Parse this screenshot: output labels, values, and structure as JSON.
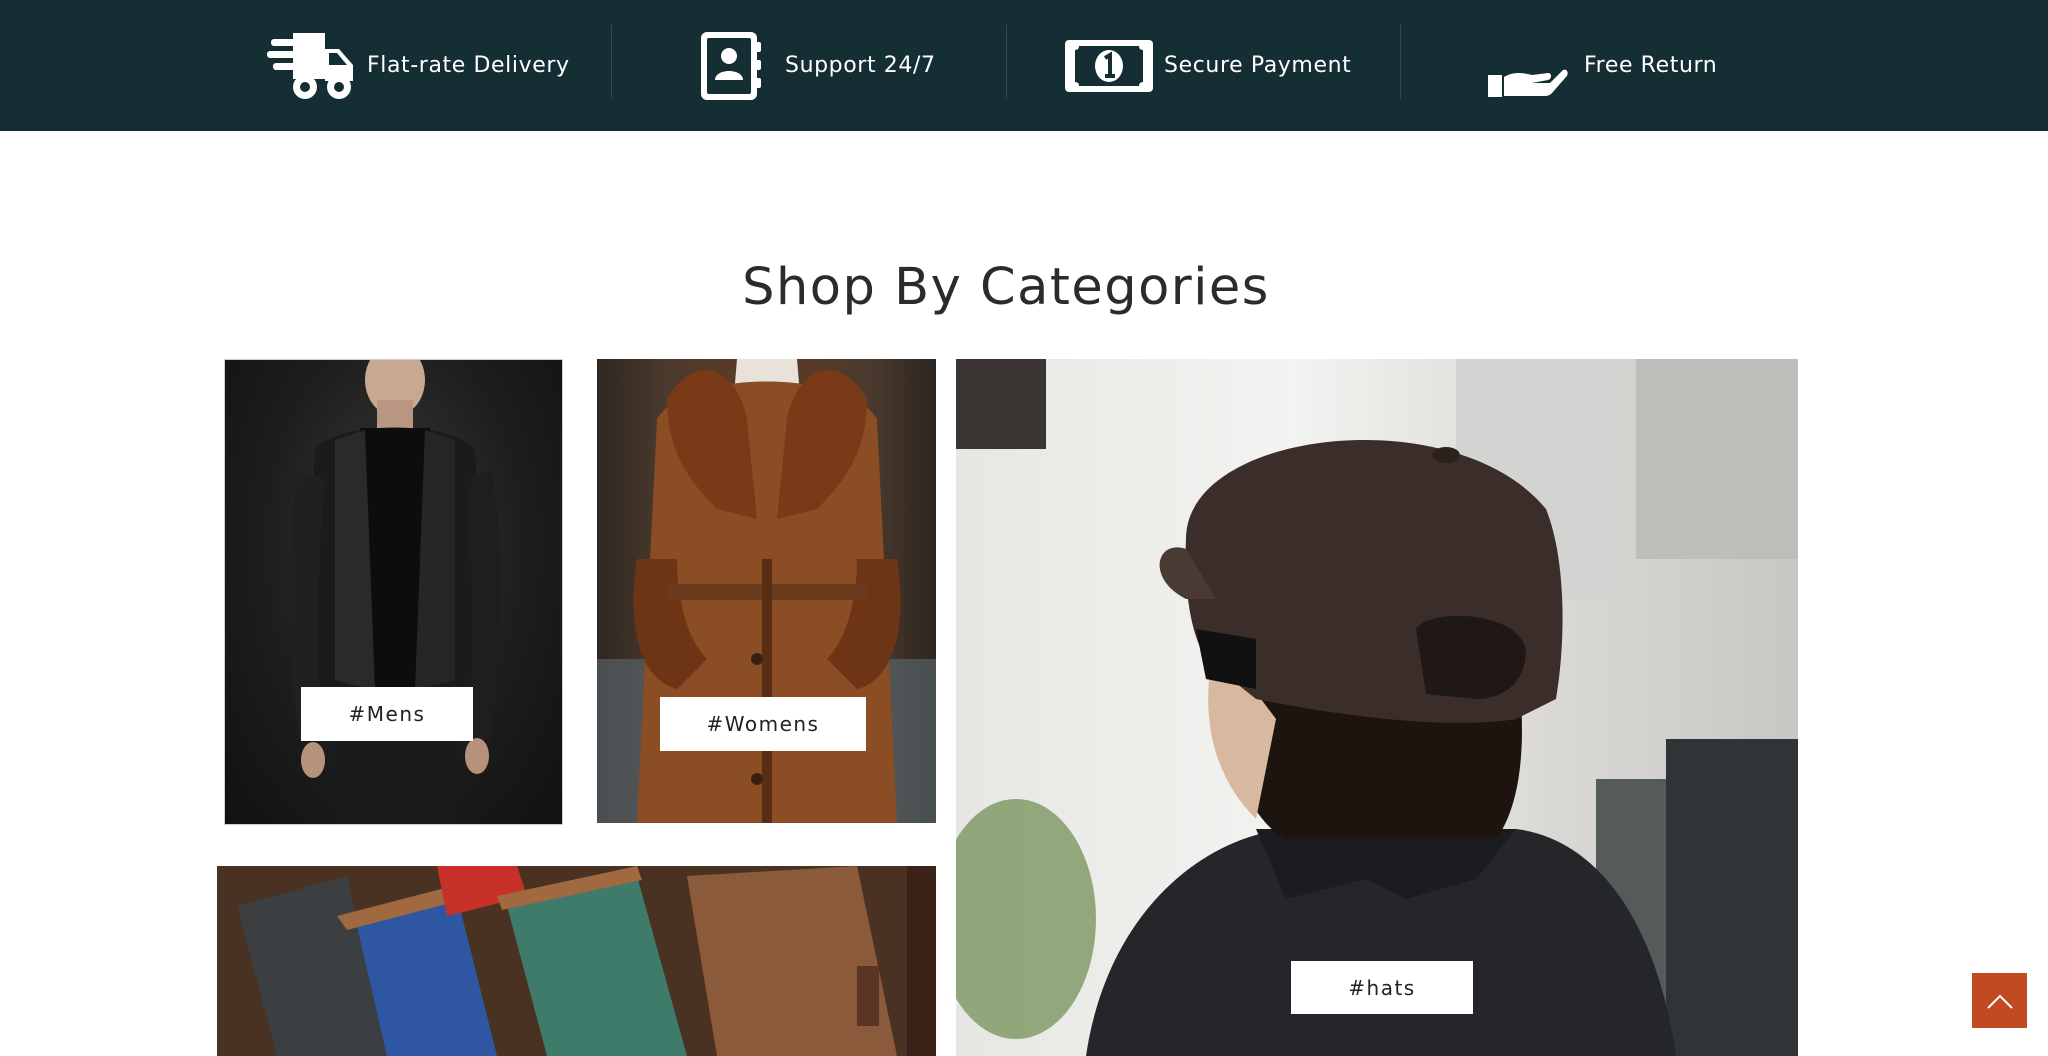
{
  "features": [
    {
      "label": "Flat-rate Delivery",
      "icon": "truck-icon"
    },
    {
      "label": "Support 24/7",
      "icon": "contact-book-icon"
    },
    {
      "label": "Secure Payment",
      "icon": "money-bill-icon"
    },
    {
      "label": "Free Return",
      "icon": "hand-icon"
    }
  ],
  "section": {
    "title": "Shop By Categories"
  },
  "categories": [
    {
      "tag": "#Mens"
    },
    {
      "tag": "#Womens"
    },
    {
      "tag": "#hats"
    }
  ],
  "colors": {
    "bar_background": "#142e34",
    "accent": "#c24a23"
  },
  "back_to_top": {
    "icon": "chevron-up-icon"
  }
}
